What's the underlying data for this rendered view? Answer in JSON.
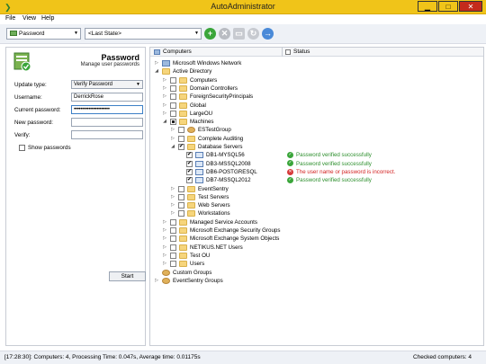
{
  "window": {
    "title": "AutoAdministrator"
  },
  "menu": [
    "File",
    "View",
    "Help"
  ],
  "toolbar": {
    "action_combo": "Password",
    "state_combo": "<Last State>"
  },
  "left": {
    "title": "Password",
    "subtitle": "Manage user passwords",
    "update_type_label": "Update type:",
    "update_type_value": "Verify Password",
    "username_label": "Username:",
    "username_value": "DerrickRose",
    "current_password_label": "Current password:",
    "current_password_value": "••••••••••••••••••••••",
    "new_password_label": "New password:",
    "new_password_value": "",
    "verify_label": "Verify:",
    "verify_value": "",
    "show_passwords_label": "Show passwords",
    "start_label": "Start"
  },
  "tree": {
    "header_computers": "Computers",
    "header_status": "Status",
    "rows": [
      {
        "label": "Microsoft Windows Network"
      },
      {
        "label": "Active Directory"
      },
      {
        "label": "Computers"
      },
      {
        "label": "Domain Controllers"
      },
      {
        "label": "ForeignSecurityPrincipals"
      },
      {
        "label": "Global"
      },
      {
        "label": "LargeOU"
      },
      {
        "label": "Machines"
      },
      {
        "label": "ESTestGroup"
      },
      {
        "label": "Complete Auditing"
      },
      {
        "label": "Database Servers"
      },
      {
        "label": "DB1-MYSQL56",
        "status": "Password verified successfully"
      },
      {
        "label": "DB3-MSSQL2008",
        "status": "Password verified successfully"
      },
      {
        "label": "DB6-POSTGRESQL",
        "status": "The user name or password is incorrect."
      },
      {
        "label": "DB7-MSSQL2012",
        "status": "Password verified successfully"
      },
      {
        "label": "EventSentry"
      },
      {
        "label": "Test Servers"
      },
      {
        "label": "Web Servers"
      },
      {
        "label": "Workstations"
      },
      {
        "label": "Managed Service Accounts"
      },
      {
        "label": "Microsoft Exchange Security Groups"
      },
      {
        "label": "Microsoft Exchange System Objects"
      },
      {
        "label": "NETIKUS.NET Users"
      },
      {
        "label": "Test OU"
      },
      {
        "label": "Users"
      },
      {
        "label": "Custom Groups"
      },
      {
        "label": "EventSentry Groups"
      }
    ]
  },
  "statusbar": {
    "left": "[17:28:30]: Computers: 4, Processing Time: 0.047s, Average time: 0.01175s",
    "right": "Checked computers: 4"
  },
  "colors": {
    "titlebar": "#f0c419",
    "ok": "#2d8f2d",
    "error": "#d21f1f"
  }
}
